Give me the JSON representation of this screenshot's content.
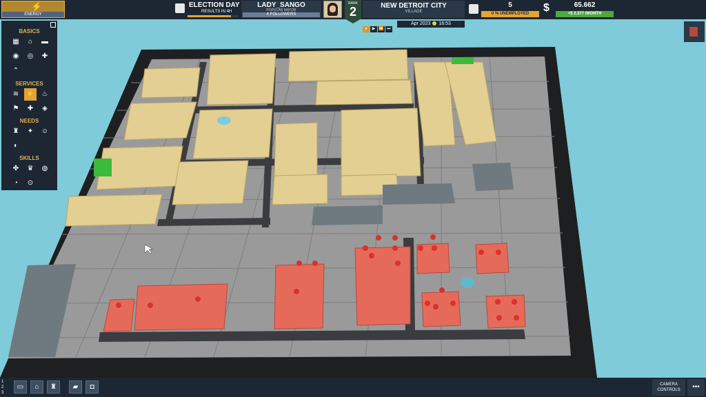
{
  "energy": {
    "label": "ENERGY",
    "icon": "lightning-bolt-icon"
  },
  "election": {
    "title": "ELECTION DAY",
    "subtitle": "RESULTS IN 4H",
    "progress": 0.85
  },
  "mayor": {
    "name": "LADY_SANGO",
    "role": "POPULAR MAYOR",
    "followers": "4 FOLLOWERS"
  },
  "rank": {
    "label": "RANK",
    "value": "2"
  },
  "city": {
    "name": "NEW DETROIT CITY",
    "tier": "VILLAGE"
  },
  "time": {
    "date": "Apr 2023",
    "clock": "16:53",
    "speed_buttons": [
      "⏸",
      "▶",
      "⏩",
      "⏭"
    ]
  },
  "jobs": {
    "value": "5",
    "unemployed": "0 % UNEMPLOYED"
  },
  "money": {
    "symbol": "$",
    "balance": "65.662",
    "income": "+$ 2.377 /MONTH"
  },
  "sidebar": {
    "basics": "BASICS",
    "services": "SERVICES",
    "needs": "NEEDS",
    "skills": "SKILLS"
  },
  "bottom": {
    "numbers": [
      "1",
      "2",
      "3"
    ],
    "camera": "CAMERA CONTROLS",
    "more": "•••"
  },
  "colors": {
    "hud": "#1c2733",
    "accent": "#e2a23a",
    "housing": "#e3cf92",
    "powered": "#e66a5a",
    "water": "#7fcbd9"
  }
}
